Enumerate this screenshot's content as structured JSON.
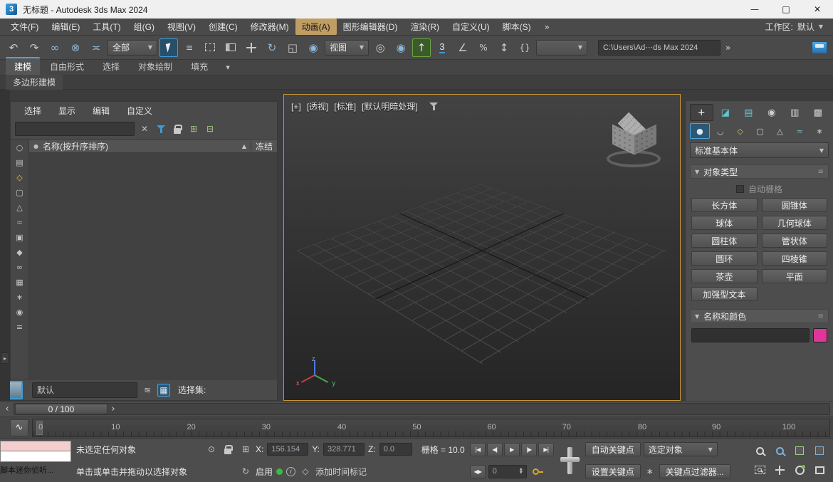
{
  "colors": {
    "accent_blue": "#3e9bd6",
    "active_viewport_border": "#c79538",
    "keyboard_override_green": "#6aa63e",
    "object_color_swatch": "#e0369b",
    "listener_macro_pink": "#f2cece",
    "listener_mini_white": "#ffffff",
    "menu_highlight_tan": "#bf9d63"
  },
  "title_bar": {
    "app_badge": "3",
    "title": "无标题 - Autodesk 3ds Max 2024",
    "minimize": "—",
    "maximize": "□",
    "close": "✕"
  },
  "menu_bar": {
    "items": [
      "文件(F)",
      "编辑(E)",
      "工具(T)",
      "组(G)",
      "视图(V)",
      "创建(C)",
      "修改器(M)",
      "动画(A)",
      "图形编辑器(D)",
      "渲染(R)",
      "自定义(U)",
      "脚本(S)"
    ],
    "overflow": "»",
    "workspace_label": "工作区:",
    "workspace_value": "默认"
  },
  "toolbar": {
    "selection_filter_value": "全部",
    "coord_system_value": "视图",
    "project_path": "C:\\Users\\Ad⋯ds Max 2024",
    "overflow": "»"
  },
  "ribbon": {
    "tabs": [
      "建模",
      "自由形式",
      "选择",
      "对象绘制",
      "填充"
    ],
    "subtab": "多边形建模"
  },
  "scene_explorer": {
    "menus": [
      "选择",
      "显示",
      "编辑",
      "自定义"
    ],
    "search_value": "",
    "column_name": "名称(按升序排序)",
    "sort_arrow": "▲",
    "column_frozen": "冻结",
    "bottom_combo_value": "默认",
    "selection_set_label": "选择集:"
  },
  "viewport": {
    "menu_general": "[+]",
    "menu_pov": "[透视]",
    "menu_standard": "[标准]",
    "menu_shading": "[默认明暗处理]",
    "axis_x": "x",
    "axis_y": "y",
    "axis_z": "z"
  },
  "command_panel": {
    "category_value": "标准基本体",
    "object_type_title": "对象类型",
    "autogrid_label": "自动栅格",
    "object_type_buttons": [
      "长方体",
      "圆锥体",
      "球体",
      "几何球体",
      "圆柱体",
      "管状体",
      "圆环",
      "四棱锥",
      "茶壶",
      "平面",
      "加强型文本"
    ],
    "name_color_title": "名称和颜色",
    "name_value": ""
  },
  "time_slider": {
    "value": "0 / 100",
    "prev": "‹",
    "next": "›"
  },
  "track_bar": {
    "ticks": [
      "0",
      "10",
      "20",
      "30",
      "40",
      "50",
      "60",
      "70",
      "80",
      "90",
      "100"
    ]
  },
  "status_bar": {
    "listener_label": "脚本迷你侦听...",
    "prompt_line1": "未选定任何对象",
    "prompt_line2": "单击或单击并拖动以选择对象",
    "x_label": "X:",
    "x_value": "156.154",
    "y_label": "Y:",
    "y_value": "328.771",
    "z_label": "Z:",
    "z_value": "0.0",
    "grid_readout": "栅格 = 10.0",
    "enable_label": "启用",
    "info_glyph": "i",
    "add_time_tag_label": "添加时间标记",
    "frame_value": "0",
    "auto_key_label": "自动关键点",
    "set_key_label": "设置关键点",
    "selection_combo_value": "选定对象",
    "key_filters_label": "关键点过滤器..."
  },
  "icons": {
    "undo": "↶",
    "redo": "↷",
    "link": "∞",
    "unlink": "⊗",
    "bind_spacewarp": "≍",
    "dropdown": "▼",
    "select_by_name": "≡",
    "rotate": "↻",
    "scale": "◱",
    "place": "◉",
    "pivot": "◎",
    "kbd_override": "↑",
    "snap_3d": "3",
    "angle_snap": "∠",
    "percent_snap": "%",
    "spinner_snap": "↕",
    "named_sets": "{}",
    "clear": "✕",
    "tree_open": "⊞",
    "tree_close": "⊟",
    "header_type": "●",
    "layers": "≋",
    "explorer_toggle": "▦",
    "expand_arrow": "▸",
    "curve_editor": "∿",
    "ribbon_flyout": "▼",
    "cp_tabs": [
      "+",
      "◪",
      "▤",
      "◉",
      "▥",
      "▩"
    ],
    "cp_sub": [
      "●",
      "◡",
      "◇",
      "▢",
      "△",
      "≈",
      "∗"
    ],
    "explorer_filters": [
      "○",
      "▤",
      "◇",
      "▢",
      "△",
      "≈",
      "▣",
      "◆",
      "∞",
      "▦",
      "∗",
      "◉",
      "≡"
    ],
    "playback_start": "|◀",
    "playback_prev": "◀|",
    "playback_play": "▶",
    "playback_next": "|▶",
    "playback_end": "▶|",
    "key_mode": "◀▶",
    "spin_up": "▲",
    "spin_down": "▼",
    "isolate": "⊙",
    "typein_toggle": "⊞",
    "adaptive": "↻",
    "time_tag": "◇",
    "key_filter_gear": "∗",
    "rollout_arrow": "▼",
    "rollout_grip": "≡"
  }
}
